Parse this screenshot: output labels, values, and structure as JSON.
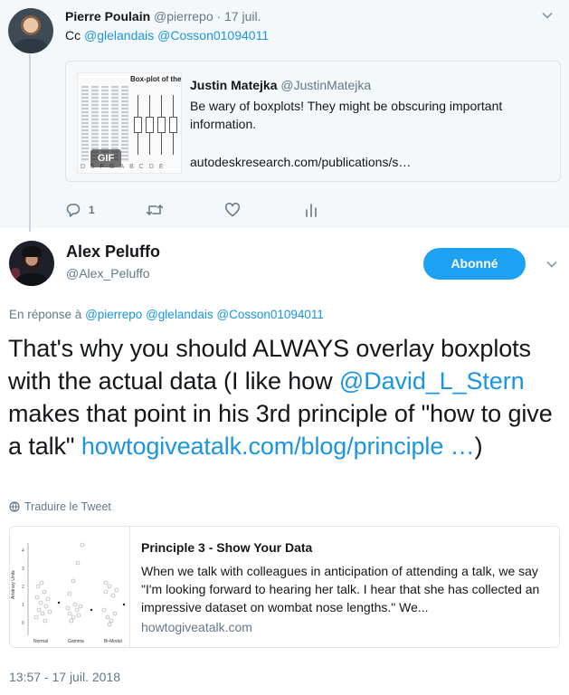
{
  "parent_tweet": {
    "author_name": "Pierre Poulain",
    "author_handle": "@pierrepo",
    "separator": "·",
    "date": "17 juil.",
    "text_prefix": "Cc",
    "mentions": [
      "@glelandais",
      "@Cosson01094011"
    ],
    "quoted_tweet": {
      "author_name": "Justin Matejka",
      "author_handle": "@JustinMatejka",
      "text": "Be wary of boxplots! They might be obscuring important information.",
      "url": "autodeskresearch.com/publications/s…",
      "media_title": "Box-plot of the",
      "media_badge": "GIF",
      "media_axis_letters": "DEFGABCDE"
    },
    "actions": {
      "reply_count": "1",
      "icons": [
        "reply-icon",
        "retweet-icon",
        "like-icon",
        "analytics-icon"
      ]
    }
  },
  "main_tweet": {
    "author_name": "Alex Peluffo",
    "author_handle": "@Alex_Peluffo",
    "follow_label": "Abonné",
    "reply_to_prefix": "En réponse à",
    "reply_to_mentions": [
      "@pierrepo",
      "@glelandais",
      "@Cosson01094011"
    ],
    "text_part1": "That's why you should ALWAYS overlay boxplots with the actual data (I like how",
    "text_mention": "@David_L_Stern",
    "text_part2": "makes that point in his 3rd principle of \"how to give a talk\"",
    "text_link": "howtogiveatalk.com/blog/principle …",
    "text_end": ")",
    "translate_label": "Traduire le Tweet",
    "card": {
      "title": "Principle 3 - Show Your Data",
      "description": "When we talk with colleagues in anticipation of attending a talk, we say \"I'm looking forward to hearing her talk. I hear that she has collected an impressive dataset on wombat nose lengths.\" We...",
      "domain": "howtogiveatalk.com",
      "thumbnail": {
        "ylabel": "Arbitrary Units",
        "yticks": [
          "0",
          "1",
          "2",
          "3",
          "4"
        ],
        "categories": [
          "Normal",
          "Gamma",
          "Bi-Modal"
        ]
      }
    },
    "timestamp": "13:57 - 17 juil. 2018"
  },
  "colors": {
    "link": "#1b95e0",
    "follow_button": "#1da1f2",
    "muted_text": "#657786",
    "parent_background": "#f5f8fa"
  }
}
